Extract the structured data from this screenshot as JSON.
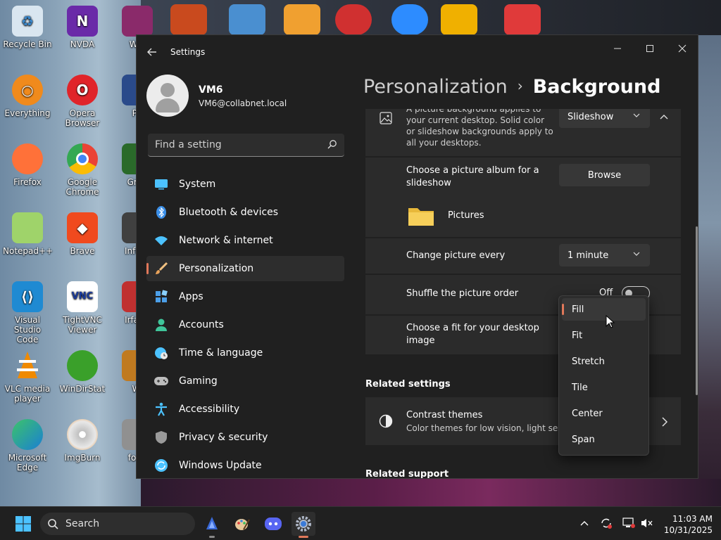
{
  "desktop": {
    "icons": [
      {
        "label": "Recycle Bin"
      },
      {
        "label": "NVDA"
      },
      {
        "label": "Win"
      },
      {
        "label": "Everything"
      },
      {
        "label": "Opera Browser"
      },
      {
        "label": "Pu"
      },
      {
        "label": "Firefox"
      },
      {
        "label": "Google Chrome"
      },
      {
        "label": "Gree"
      },
      {
        "label": "Notepad++"
      },
      {
        "label": "Brave"
      },
      {
        "label": "InfraR"
      },
      {
        "label": "Visual Studio Code"
      },
      {
        "label": "TightVNC Viewer"
      },
      {
        "label": "IrfanV"
      },
      {
        "label": "VLC media player"
      },
      {
        "label": "WinDirStat"
      },
      {
        "label": "Wi"
      },
      {
        "label": "Microsoft Edge"
      },
      {
        "label": "ImgBurn"
      },
      {
        "label": "foob"
      }
    ]
  },
  "window": {
    "title": "Settings",
    "controls": {
      "minimize": "—",
      "maximize": "☐",
      "close": "✕"
    }
  },
  "profile": {
    "name": "VM6",
    "email": "VM6@collabnet.local"
  },
  "search": {
    "placeholder": "Find a setting"
  },
  "nav": {
    "items": [
      {
        "label": "System",
        "icon": "monitor-icon",
        "color": "#4cc2ff"
      },
      {
        "label": "Bluetooth & devices",
        "icon": "bluetooth-icon",
        "color": "#3b8fe8"
      },
      {
        "label": "Network & internet",
        "icon": "wifi-icon",
        "color": "#4cc2ff"
      },
      {
        "label": "Personalization",
        "icon": "brush-icon",
        "color": "#e8a25a"
      },
      {
        "label": "Apps",
        "icon": "apps-icon",
        "color": "#4c9fe8"
      },
      {
        "label": "Accounts",
        "icon": "person-icon",
        "color": "#3fc59a"
      },
      {
        "label": "Time & language",
        "icon": "globe-clock-icon",
        "color": "#4cc2ff"
      },
      {
        "label": "Gaming",
        "icon": "gamepad-icon",
        "color": "#bdbdbd"
      },
      {
        "label": "Accessibility",
        "icon": "accessibility-icon",
        "color": "#4cc2ff"
      },
      {
        "label": "Privacy & security",
        "icon": "shield-icon",
        "color": "#9a9a9a"
      },
      {
        "label": "Windows Update",
        "icon": "update-icon",
        "color": "#4cc2ff"
      }
    ],
    "active_index": 3
  },
  "breadcrumb": {
    "parent": "Personalization",
    "separator": "›",
    "current": "Background"
  },
  "content": {
    "background_card": {
      "sub": "A picture background applies to your current desktop. Solid color or slideshow backgrounds apply to all your desktops.",
      "dropdown_value": "Slideshow"
    },
    "album": {
      "label": "Choose a picture album for a slideshow",
      "button": "Browse",
      "folder": "Pictures"
    },
    "change_every": {
      "label": "Change picture every",
      "value": "1 minute"
    },
    "shuffle": {
      "label": "Shuffle the picture order",
      "state": "Off"
    },
    "fit": {
      "label": "Choose a fit for your desktop image"
    },
    "related_settings": {
      "title": "Related settings"
    },
    "contrast": {
      "label": "Contrast themes",
      "sub": "Color themes for low vision, light sensiti"
    },
    "related_support": {
      "title": "Related support"
    }
  },
  "fit_menu": {
    "options": [
      "Fill",
      "Fit",
      "Stretch",
      "Tile",
      "Center",
      "Span"
    ],
    "selected_index": 0
  },
  "taskbar": {
    "search_label": "Search",
    "apps": [
      "nvda-app",
      "paint-app",
      "discord-app",
      "settings-app"
    ],
    "active_app": "settings-app",
    "time": "11:03 AM",
    "date": "10/31/2025"
  },
  "colors": {
    "accent": "#e0785a",
    "window_bg": "#202020",
    "card_bg": "#2b2b2b"
  }
}
